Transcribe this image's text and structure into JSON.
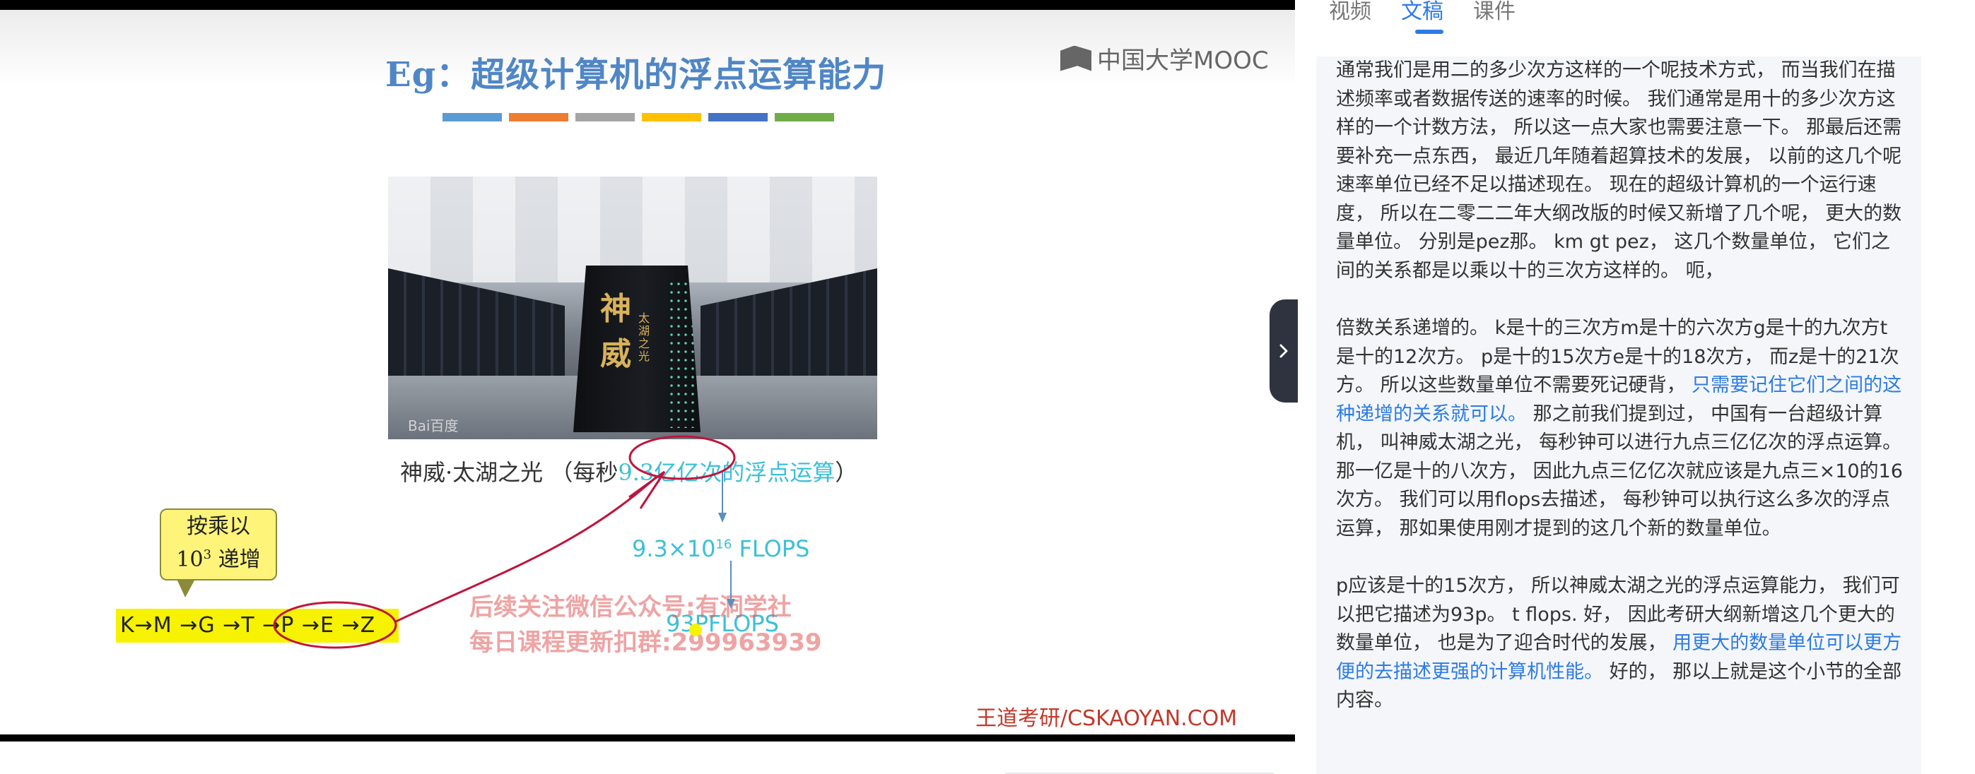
{
  "tabs": [
    {
      "label": "视频",
      "active": false
    },
    {
      "label": "文稿",
      "active": true
    },
    {
      "label": "课件",
      "active": false
    }
  ],
  "slide": {
    "title": "Eg：超级计算机的浮点运算能力",
    "mooc_logo": "中国大学MOOC",
    "color_bars": [
      "#5b9bd5",
      "#ed7d31",
      "#a5a5a5",
      "#ffc000",
      "#4472c4",
      "#70ad47"
    ],
    "photo_chars": "神威",
    "photo_sub": "太湖之光",
    "photo_watermark": "Bai百度",
    "caption_pre": "神威·太湖之光 （每秒",
    "caption_hl": "9.3亿亿次的浮点运算",
    "caption_post": "）",
    "callout_line1": "按乘以",
    "callout_base": "10",
    "callout_exp": "3",
    "callout_tail": "递增",
    "units_chain": "K→M →G →T →P →E →Z",
    "flops1_base": "9.3×10",
    "flops1_exp": "16",
    "flops1_unit": " FLOPS",
    "flops2": "93PFLOPS",
    "watermark_line1": "后续关注微信公众号:有洞学社",
    "watermark_line2": "每日课程更新扣群:299963939",
    "brand": "王道考研/CSKAOYAN.COM"
  },
  "transcript": {
    "paragraphs": [
      {
        "segments": [
          {
            "text": "通常我们是用二的多少次方这样的一个呢技术方式， 而当我们在描述频率或者数据传送的速率的时候。 我们通常是用十的多少次方这样的一个计数方法， 所以这一点大家也需要注意一下。 那最后还需要补充一点东西， 最近几年随着超算技术的发展， 以前的这几个呢速率单位已经不足以描述现在。 现在的超级计算机的一个运行速度， 所以在二零二二年大纲改版的时候又新增了几个呢， 更大的数量单位。 分别是pez那。 km gt pez， 这几个数量单位， 它们之间的关系都是以乘以十的三次方这样的。 呃，",
            "link": false
          }
        ]
      },
      {
        "segments": [
          {
            "text": "倍数关系递增的。 k是十的三次方m是十的六次方g是十的九次方t是十的12次方。 p是十的15次方e是十的18次方， 而z是十的21次方。 所以这些数量单位不需要死记硬背， ",
            "link": false
          },
          {
            "text": "只需要记住它们之间的这种递增的关系就可以。",
            "link": true
          },
          {
            "text": " 那之前我们提到过， 中国有一台超级计算机， 叫神威太湖之光， 每秒钟可以进行九点三亿亿次的浮点运算。 那一亿是十的八次方， 因此九点三亿亿次就应该是九点三×10的16次方。 我们可以用flops去描述， 每秒钟可以执行这么多次的浮点运算， 那如果使用刚才提到的这几个新的数量单位。",
            "link": false
          }
        ]
      },
      {
        "segments": [
          {
            "text": "p应该是十的15次方， 所以神威太湖之光的浮点运算能力， 我们可以把它描述为93p。 t flops. 好， 因此考研大纲新增这几个更大的数量单位， 也是为了迎合时代的发展， ",
            "link": false
          },
          {
            "text": "用更大的数量单位可以更方便的去描述更强的计算机性能。",
            "link": true
          },
          {
            "text": " 好的， 那以上就是这个小节的全部内容。",
            "link": false
          }
        ]
      }
    ]
  },
  "colors": {
    "accent": "#2c7be5",
    "slide_title": "#4f86c6",
    "highlight_cyan": "#3cc0d8",
    "annotation_red": "#c0143c",
    "units_yellow": "#f6f200"
  }
}
